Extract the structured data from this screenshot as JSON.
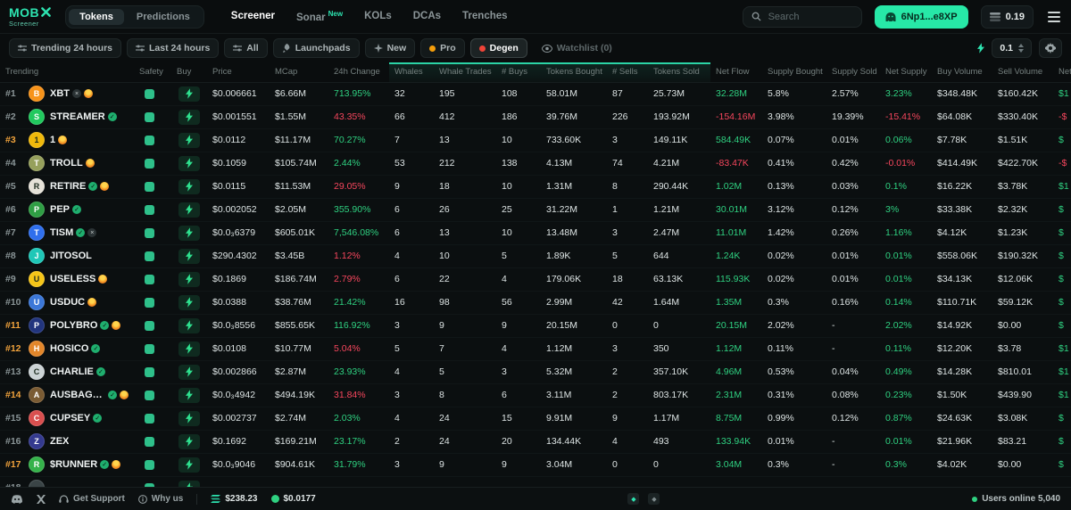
{
  "topbar": {
    "logo_main": "MOB",
    "logo_sub": "Screener",
    "tabs": [
      {
        "label": "Tokens",
        "active": true
      },
      {
        "label": "Predictions",
        "active": false
      }
    ],
    "nav": [
      {
        "label": "Screener",
        "active": true
      },
      {
        "label": "Sonar",
        "badge": "New"
      },
      {
        "label": "KOLs"
      },
      {
        "label": "DCAs"
      },
      {
        "label": "Trenches"
      }
    ],
    "search_placeholder": "Search",
    "wallet_label": "6Np1...e8XP",
    "balance": "0.19"
  },
  "filterbar": {
    "buttons": [
      {
        "label": "Trending 24 hours",
        "icon": "sliders"
      },
      {
        "label": "Last 24 hours",
        "icon": "sliders"
      },
      {
        "label": "All",
        "icon": "sliders"
      },
      {
        "label": "Launchpads",
        "icon": "launch"
      },
      {
        "label": "New",
        "icon": "sparkle"
      },
      {
        "label": "Pro",
        "icon": "dot-orange"
      },
      {
        "label": "Degen",
        "icon": "dot-red",
        "active": true
      },
      {
        "label": "Watchlist (0)",
        "icon": "eye",
        "muted": true
      }
    ],
    "quick_buy_value": "0.1"
  },
  "table": {
    "columns": [
      {
        "label": "Trending"
      },
      {
        "label": "Safety"
      },
      {
        "label": "Buy"
      },
      {
        "label": "Price"
      },
      {
        "label": "MCap"
      },
      {
        "label": "24h Change"
      },
      {
        "label": "Whales",
        "hl": true
      },
      {
        "label": "Whale Trades",
        "hl": true
      },
      {
        "label": "# Buys",
        "hl": true
      },
      {
        "label": "Tokens Bought",
        "hl": true
      },
      {
        "label": "# Sells",
        "hl": true
      },
      {
        "label": "Tokens Sold",
        "hl": true
      },
      {
        "label": "Net Flow"
      },
      {
        "label": "Supply Bought"
      },
      {
        "label": "Supply Sold"
      },
      {
        "label": "Net Supply"
      },
      {
        "label": "Buy Volume"
      },
      {
        "label": "Sell Volume"
      },
      {
        "label": "Net Volume"
      }
    ],
    "rows": [
      {
        "rank": "#1",
        "hl": false,
        "name": "XBT",
        "color": "#f7931a",
        "letter": "B",
        "dark": false,
        "badges": [
          "x",
          "fire"
        ],
        "price": "$0.006661",
        "mcap": "$6.66M",
        "chg": "713.95%",
        "up": true,
        "whales": "32",
        "wtrades": "195",
        "buys": "108",
        "tbought": "58.01M",
        "sells": "87",
        "tsold": "25.73M",
        "nflow": "32.28M",
        "nflow_pos": true,
        "sbought": "5.8%",
        "ssold": "2.57%",
        "nsupply": "3.23%",
        "nsupply_pos": true,
        "bvol": "$348.48K",
        "svol": "$160.42K",
        "nvol": "$1",
        "nvol_pos": true
      },
      {
        "rank": "#2",
        "hl": false,
        "name": "STREAMER",
        "color": "#21c95e",
        "letter": "S",
        "dark": false,
        "badges": [
          "check"
        ],
        "price": "$0.001551",
        "mcap": "$1.55M",
        "chg": "43.35%",
        "up": false,
        "whales": "66",
        "wtrades": "412",
        "buys": "186",
        "tbought": "39.76M",
        "sells": "226",
        "tsold": "193.92M",
        "nflow": "-154.16M",
        "nflow_pos": false,
        "sbought": "3.98%",
        "ssold": "19.39%",
        "nsupply": "-15.41%",
        "nsupply_pos": false,
        "bvol": "$64.08K",
        "svol": "$330.40K",
        "nvol": "-$",
        "nvol_pos": false
      },
      {
        "rank": "#3",
        "hl": true,
        "name": "1",
        "color": "#f0b90b",
        "letter": "1",
        "dark": true,
        "badges": [
          "fire"
        ],
        "price": "$0.0112",
        "mcap": "$11.17M",
        "chg": "70.27%",
        "up": true,
        "whales": "7",
        "wtrades": "13",
        "buys": "10",
        "tbought": "733.60K",
        "sells": "3",
        "tsold": "149.11K",
        "nflow": "584.49K",
        "nflow_pos": true,
        "sbought": "0.07%",
        "ssold": "0.01%",
        "nsupply": "0.06%",
        "nsupply_pos": true,
        "bvol": "$7.78K",
        "svol": "$1.51K",
        "nvol": "$",
        "nvol_pos": true
      },
      {
        "rank": "#4",
        "hl": false,
        "name": "TROLL",
        "color": "#96a05c",
        "letter": "T",
        "dark": false,
        "badges": [
          "fire"
        ],
        "price": "$0.1059",
        "mcap": "$105.74M",
        "chg": "2.44%",
        "up": true,
        "whales": "53",
        "wtrades": "212",
        "buys": "138",
        "tbought": "4.13M",
        "sells": "74",
        "tsold": "4.21M",
        "nflow": "-83.47K",
        "nflow_pos": false,
        "sbought": "0.41%",
        "ssold": "0.42%",
        "nsupply": "-0.01%",
        "nsupply_pos": false,
        "bvol": "$414.49K",
        "svol": "$422.70K",
        "nvol": "-$",
        "nvol_pos": false
      },
      {
        "rank": "#5",
        "hl": false,
        "name": "RETIRE",
        "color": "#e6e2d8",
        "letter": "R",
        "dark": true,
        "badges": [
          "check",
          "fire"
        ],
        "price": "$0.0115",
        "mcap": "$11.53M",
        "chg": "29.05%",
        "up": false,
        "whales": "9",
        "wtrades": "18",
        "buys": "10",
        "tbought": "1.31M",
        "sells": "8",
        "tsold": "290.44K",
        "nflow": "1.02M",
        "nflow_pos": true,
        "sbought": "0.13%",
        "ssold": "0.03%",
        "nsupply": "0.1%",
        "nsupply_pos": true,
        "bvol": "$16.22K",
        "svol": "$3.78K",
        "nvol": "$1",
        "nvol_pos": true
      },
      {
        "rank": "#6",
        "hl": false,
        "name": "PEP",
        "color": "#2f9e44",
        "letter": "P",
        "dark": false,
        "badges": [
          "check"
        ],
        "price": "$0.002052",
        "mcap": "$2.05M",
        "chg": "355.90%",
        "up": true,
        "whales": "6",
        "wtrades": "26",
        "buys": "25",
        "tbought": "31.22M",
        "sells": "1",
        "tsold": "1.21M",
        "nflow": "30.01M",
        "nflow_pos": true,
        "sbought": "3.12%",
        "ssold": "0.12%",
        "nsupply": "3%",
        "nsupply_pos": true,
        "bvol": "$33.38K",
        "svol": "$2.32K",
        "nvol": "$",
        "nvol_pos": true
      },
      {
        "rank": "#7",
        "hl": false,
        "name": "TISM",
        "color": "#2f6fed",
        "letter": "T",
        "dark": false,
        "badges": [
          "check",
          "x"
        ],
        "price": "$0.0₃6379",
        "mcap": "$605.01K",
        "chg": "7,546.08%",
        "up": true,
        "whales": "6",
        "wtrades": "13",
        "buys": "10",
        "tbought": "13.48M",
        "sells": "3",
        "tsold": "2.47M",
        "nflow": "11.01M",
        "nflow_pos": true,
        "sbought": "1.42%",
        "ssold": "0.26%",
        "nsupply": "1.16%",
        "nsupply_pos": true,
        "bvol": "$4.12K",
        "svol": "$1.23K",
        "nvol": "$",
        "nvol_pos": true
      },
      {
        "rank": "#8",
        "hl": false,
        "name": "JITOSOL",
        "color": "#1fc7b7",
        "letter": "J",
        "dark": false,
        "badges": [],
        "price": "$290.4302",
        "mcap": "$3.45B",
        "chg": "1.12%",
        "up": false,
        "whales": "4",
        "wtrades": "10",
        "buys": "5",
        "tbought": "1.89K",
        "sells": "5",
        "tsold": "644",
        "nflow": "1.24K",
        "nflow_pos": true,
        "sbought": "0.02%",
        "ssold": "0.01%",
        "nsupply": "0.01%",
        "nsupply_pos": true,
        "bvol": "$558.06K",
        "svol": "$190.32K",
        "nvol": "$",
        "nvol_pos": true
      },
      {
        "rank": "#9",
        "hl": false,
        "name": "USELESS",
        "color": "#f5c518",
        "letter": "U",
        "dark": true,
        "badges": [
          "fire"
        ],
        "price": "$0.1869",
        "mcap": "$186.74M",
        "chg": "2.79%",
        "up": false,
        "whales": "6",
        "wtrades": "22",
        "buys": "4",
        "tbought": "179.06K",
        "sells": "18",
        "tsold": "63.13K",
        "nflow": "115.93K",
        "nflow_pos": true,
        "sbought": "0.02%",
        "ssold": "0.01%",
        "nsupply": "0.01%",
        "nsupply_pos": true,
        "bvol": "$34.13K",
        "svol": "$12.06K",
        "nvol": "$",
        "nvol_pos": true
      },
      {
        "rank": "#10",
        "hl": false,
        "name": "USDUC",
        "color": "#3b77d8",
        "letter": "U",
        "dark": false,
        "badges": [
          "fire"
        ],
        "price": "$0.0388",
        "mcap": "$38.76M",
        "chg": "21.42%",
        "up": true,
        "whales": "16",
        "wtrades": "98",
        "buys": "56",
        "tbought": "2.99M",
        "sells": "42",
        "tsold": "1.64M",
        "nflow": "1.35M",
        "nflow_pos": true,
        "sbought": "0.3%",
        "ssold": "0.16%",
        "nsupply": "0.14%",
        "nsupply_pos": true,
        "bvol": "$110.71K",
        "svol": "$59.12K",
        "nvol": "$",
        "nvol_pos": true
      },
      {
        "rank": "#11",
        "hl": true,
        "name": "POLYBRO",
        "color": "#22357e",
        "letter": "P",
        "dark": false,
        "badges": [
          "check",
          "fire"
        ],
        "price": "$0.0₃8556",
        "mcap": "$855.65K",
        "chg": "116.92%",
        "up": true,
        "whales": "3",
        "wtrades": "9",
        "buys": "9",
        "tbought": "20.15M",
        "sells": "0",
        "tsold": "0",
        "nflow": "20.15M",
        "nflow_pos": true,
        "sbought": "2.02%",
        "ssold": "-",
        "nsupply": "2.02%",
        "nsupply_pos": true,
        "bvol": "$14.92K",
        "svol": "$0.00",
        "nvol": "$",
        "nvol_pos": true
      },
      {
        "rank": "#12",
        "hl": true,
        "name": "HOSICO",
        "color": "#e2862a",
        "letter": "H",
        "dark": false,
        "badges": [
          "check"
        ],
        "price": "$0.0108",
        "mcap": "$10.77M",
        "chg": "5.04%",
        "up": false,
        "whales": "5",
        "wtrades": "7",
        "buys": "4",
        "tbought": "1.12M",
        "sells": "3",
        "tsold": "350",
        "nflow": "1.12M",
        "nflow_pos": true,
        "sbought": "0.11%",
        "ssold": "-",
        "nsupply": "0.11%",
        "nsupply_pos": true,
        "bvol": "$12.20K",
        "svol": "$3.78",
        "nvol": "$1",
        "nvol_pos": true
      },
      {
        "rank": "#13",
        "hl": false,
        "name": "CHARLIE",
        "color": "#ccd3d5",
        "letter": "C",
        "dark": true,
        "badges": [
          "check"
        ],
        "price": "$0.002866",
        "mcap": "$2.87M",
        "chg": "23.93%",
        "up": true,
        "whales": "4",
        "wtrades": "5",
        "buys": "3",
        "tbought": "5.32M",
        "sells": "2",
        "tsold": "357.10K",
        "nflow": "4.96M",
        "nflow_pos": true,
        "sbought": "0.53%",
        "ssold": "0.04%",
        "nsupply": "0.49%",
        "nsupply_pos": true,
        "bvol": "$14.28K",
        "svol": "$810.01",
        "nvol": "$1",
        "nvol_pos": true
      },
      {
        "rank": "#14",
        "hl": true,
        "name": "AUSBAGWORK",
        "color": "#7a5b33",
        "letter": "A",
        "dark": false,
        "badges": [
          "check",
          "fire"
        ],
        "price": "$0.0₃4942",
        "mcap": "$494.19K",
        "chg": "31.84%",
        "up": false,
        "whales": "3",
        "wtrades": "8",
        "buys": "6",
        "tbought": "3.11M",
        "sells": "2",
        "tsold": "803.17K",
        "nflow": "2.31M",
        "nflow_pos": true,
        "sbought": "0.31%",
        "ssold": "0.08%",
        "nsupply": "0.23%",
        "nsupply_pos": true,
        "bvol": "$1.50K",
        "svol": "$439.90",
        "nvol": "$1",
        "nvol_pos": true
      },
      {
        "rank": "#15",
        "hl": false,
        "name": "CUPSEY",
        "color": "#d94f4f",
        "letter": "C",
        "dark": false,
        "badges": [
          "check"
        ],
        "price": "$0.002737",
        "mcap": "$2.74M",
        "chg": "2.03%",
        "up": true,
        "whales": "4",
        "wtrades": "24",
        "buys": "15",
        "tbought": "9.91M",
        "sells": "9",
        "tsold": "1.17M",
        "nflow": "8.75M",
        "nflow_pos": true,
        "sbought": "0.99%",
        "ssold": "0.12%",
        "nsupply": "0.87%",
        "nsupply_pos": true,
        "bvol": "$24.63K",
        "svol": "$3.08K",
        "nvol": "$",
        "nvol_pos": true
      },
      {
        "rank": "#16",
        "hl": false,
        "name": "ZEX",
        "color": "#343a8f",
        "letter": "Z",
        "dark": false,
        "badges": [],
        "price": "$0.1692",
        "mcap": "$169.21M",
        "chg": "23.17%",
        "up": true,
        "whales": "2",
        "wtrades": "24",
        "buys": "20",
        "tbought": "134.44K",
        "sells": "4",
        "tsold": "493",
        "nflow": "133.94K",
        "nflow_pos": true,
        "sbought": "0.01%",
        "ssold": "-",
        "nsupply": "0.01%",
        "nsupply_pos": true,
        "bvol": "$21.96K",
        "svol": "$83.21",
        "nvol": "$",
        "nvol_pos": true
      },
      {
        "rank": "#17",
        "hl": true,
        "name": "$RUNNER",
        "color": "#35b24a",
        "letter": "R",
        "dark": false,
        "badges": [
          "check",
          "fire"
        ],
        "price": "$0.0₃9046",
        "mcap": "$904.61K",
        "chg": "31.79%",
        "up": true,
        "whales": "3",
        "wtrades": "9",
        "buys": "9",
        "tbought": "3.04M",
        "sells": "0",
        "tsold": "0",
        "nflow": "3.04M",
        "nflow_pos": true,
        "sbought": "0.3%",
        "ssold": "-",
        "nsupply": "0.3%",
        "nsupply_pos": true,
        "bvol": "$4.02K",
        "svol": "$0.00",
        "nvol": "$",
        "nvol_pos": true
      },
      {
        "rank": "#18",
        "hl": false,
        "name": "",
        "color": "#3a4446",
        "letter": "",
        "dark": false,
        "badges": [],
        "price": "",
        "mcap": "",
        "chg": "",
        "up": true,
        "whales": "",
        "wtrades": "",
        "buys": "",
        "tbought": "",
        "sells": "",
        "tsold": "",
        "nflow": "",
        "nflow_pos": true,
        "sbought": "",
        "ssold": "",
        "nsupply": "",
        "nsupply_pos": true,
        "bvol": "",
        "svol": "",
        "nvol": "",
        "nvol_pos": true
      }
    ]
  },
  "footer": {
    "support_label": "Get Support",
    "why_label": "Why us",
    "sol_price": "$238.23",
    "token_price": "$0.0177",
    "users_online": "Users online 5,040"
  },
  "colors": {
    "accent": "#2de3b0",
    "green": "#2fd181",
    "red": "#f6465d",
    "orange_rank": "#f0a23c",
    "wallet_green": "#27e8a7"
  }
}
